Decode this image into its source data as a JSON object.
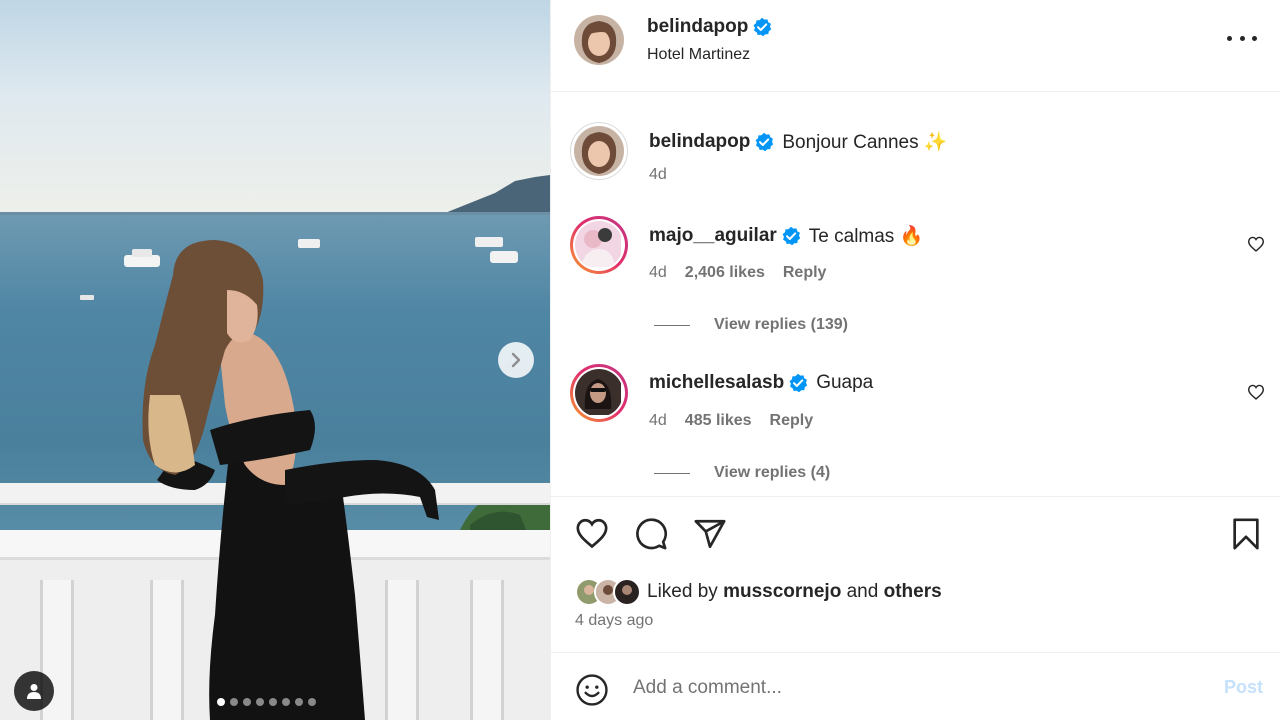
{
  "post": {
    "author": "belindapop",
    "location": "Hotel Martinez",
    "caption": "Bonjour Cannes ✨",
    "caption_age": "4d",
    "carousel": {
      "slide_count": 8,
      "active_index": 0
    }
  },
  "comments": [
    {
      "user": "majo__aguilar",
      "text": "Te calmas 🔥",
      "age": "4d",
      "likes": "2,406 likes",
      "reply": "Reply",
      "replies": "View replies (139)"
    },
    {
      "user": "michellesalasb",
      "text": "Guapa",
      "age": "4d",
      "likes": "485 likes",
      "reply": "Reply",
      "replies": "View replies (4)"
    }
  ],
  "likes": {
    "prefix": "Liked by",
    "user": "musscornejo",
    "and": "and",
    "others": "others"
  },
  "time_ago": "4 days ago",
  "composer": {
    "placeholder": "Add a comment...",
    "post_label": "Post"
  },
  "colors": {
    "verified": "#0095f6",
    "muted": "#737373",
    "post_disabled": "#c5e1fb"
  },
  "icons": [
    "more-icon",
    "verified-icon",
    "heart-icon",
    "comment-icon",
    "share-icon",
    "bookmark-icon",
    "emoji-icon",
    "tag-people-icon",
    "chevron-right-icon"
  ]
}
